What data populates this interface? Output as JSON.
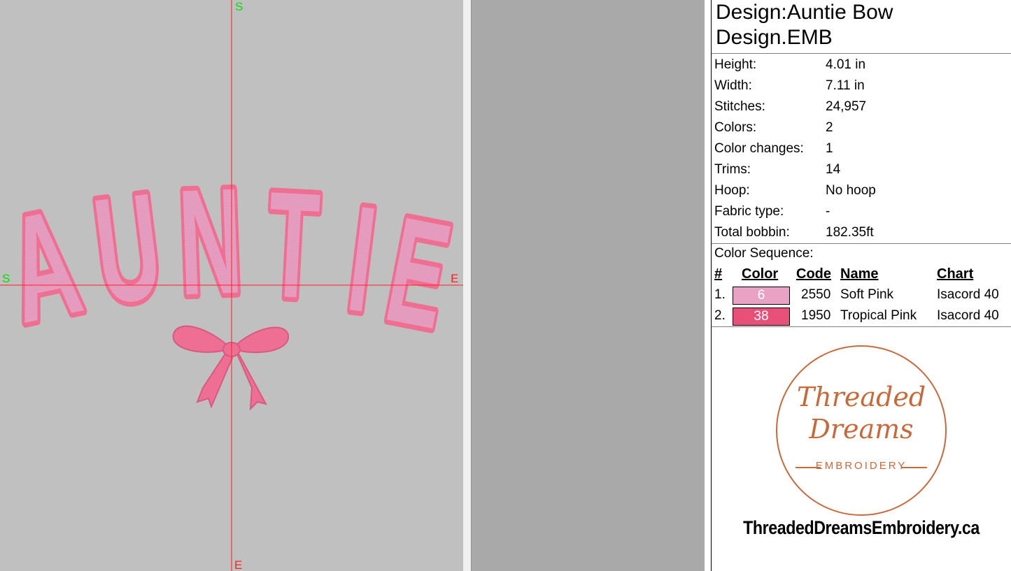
{
  "canvas": {
    "axis_labels": {
      "top": "S",
      "bottom": "E",
      "left": "S",
      "right": "E"
    },
    "design_text": "AUNTIE",
    "colors": {
      "fill": "#e9a2c3",
      "outline": "#ef6e92",
      "bow": "#ee6f93",
      "background": "#c0c0c0",
      "axis": "#ff2020",
      "axis_label": "#00e000"
    }
  },
  "design": {
    "title_line1": "Design:Auntie Bow",
    "title_line2": "Design.EMB"
  },
  "properties": [
    {
      "label": "Height:",
      "value": "4.01 in"
    },
    {
      "label": "Width:",
      "value": "7.11 in"
    },
    {
      "label": "Stitches:",
      "value": "24,957"
    },
    {
      "label": "Colors:",
      "value": "2"
    },
    {
      "label": "Color changes:",
      "value": "1"
    },
    {
      "label": "Trims:",
      "value": "14"
    },
    {
      "label": "Hoop:",
      "value": "No hoop"
    },
    {
      "label": "Fabric type:",
      "value": "-"
    },
    {
      "label": "Total bobbin:",
      "value": "182.35ft"
    }
  ],
  "color_sequence": {
    "title": "Color Sequence:",
    "headers": {
      "num": "#",
      "color": "Color",
      "code": "Code",
      "name": "Name",
      "chart": "Chart"
    },
    "rows": [
      {
        "num": "1.",
        "swatch_label": "6",
        "swatch_hex": "#e9a2c3",
        "code": "2550",
        "name": "Soft Pink",
        "chart": "Isacord 40"
      },
      {
        "num": "2.",
        "swatch_label": "38",
        "swatch_hex": "#e84f79",
        "code": "1950",
        "name": "Tropical Pink",
        "chart": "Isacord 40"
      }
    ]
  },
  "logo": {
    "script_line1": "Threaded",
    "script_line2": "Dreams",
    "subtitle": "EMBROIDERY",
    "color": "#c66a3c"
  },
  "website": "ThreadedDreamsEmbroidery.ca"
}
